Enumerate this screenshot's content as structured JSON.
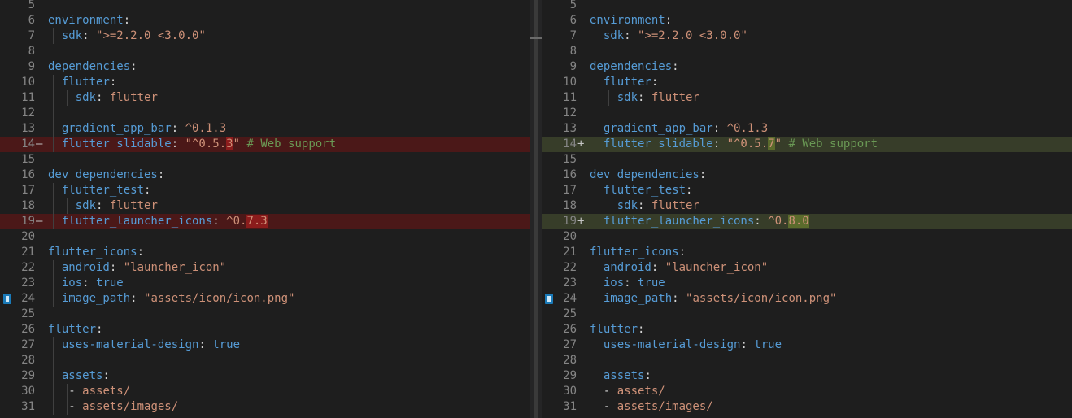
{
  "diff": {
    "left": [
      {
        "num": "5",
        "tokens": []
      },
      {
        "num": "6",
        "tokens": [
          {
            "t": "environment",
            "c": "k"
          },
          {
            "t": ":",
            "c": "p"
          }
        ]
      },
      {
        "num": "7",
        "guides": 1,
        "tokens": [
          {
            "t": "  "
          },
          {
            "t": "sdk",
            "c": "k"
          },
          {
            "t": ": ",
            "c": "p"
          },
          {
            "t": "\">=2.2.0 <3.0.0\"",
            "c": "s"
          }
        ]
      },
      {
        "num": "8",
        "tokens": []
      },
      {
        "num": "9",
        "tokens": [
          {
            "t": "dependencies",
            "c": "k"
          },
          {
            "t": ":",
            "c": "p"
          }
        ]
      },
      {
        "num": "10",
        "guides": 1,
        "tokens": [
          {
            "t": "  "
          },
          {
            "t": "flutter",
            "c": "k"
          },
          {
            "t": ":",
            "c": "p"
          }
        ]
      },
      {
        "num": "11",
        "guides": 2,
        "tokens": [
          {
            "t": "    "
          },
          {
            "t": "sdk",
            "c": "k"
          },
          {
            "t": ": ",
            "c": "p"
          },
          {
            "t": "flutter",
            "c": "s"
          }
        ]
      },
      {
        "num": "12",
        "guides": 1,
        "tokens": []
      },
      {
        "num": "13",
        "guides": 1,
        "tokens": [
          {
            "t": "  "
          },
          {
            "t": "gradient_app_bar",
            "c": "k"
          },
          {
            "t": ": ",
            "c": "p"
          },
          {
            "t": "^0.1.3",
            "c": "s"
          }
        ]
      },
      {
        "num": "14",
        "mark": "—",
        "type": "del",
        "guides": 1,
        "tokens": [
          {
            "t": "  "
          },
          {
            "t": "flutter_slidable",
            "c": "k"
          },
          {
            "t": ": ",
            "c": "p"
          },
          {
            "t": "\"^0.5.",
            "c": "s"
          },
          {
            "t": "3",
            "c": "s",
            "h": "hd"
          },
          {
            "t": "\"",
            "c": "s"
          },
          {
            "t": " # Web support",
            "c": "c"
          }
        ]
      },
      {
        "num": "15",
        "tokens": []
      },
      {
        "num": "16",
        "tokens": [
          {
            "t": "dev_dependencies",
            "c": "k"
          },
          {
            "t": ":",
            "c": "p"
          }
        ]
      },
      {
        "num": "17",
        "guides": 1,
        "tokens": [
          {
            "t": "  "
          },
          {
            "t": "flutter_test",
            "c": "k"
          },
          {
            "t": ":",
            "c": "p"
          }
        ]
      },
      {
        "num": "18",
        "guides": 2,
        "tokens": [
          {
            "t": "    "
          },
          {
            "t": "sdk",
            "c": "k"
          },
          {
            "t": ": ",
            "c": "p"
          },
          {
            "t": "flutter",
            "c": "s"
          }
        ]
      },
      {
        "num": "19",
        "mark": "—",
        "type": "del",
        "guides": 1,
        "tokens": [
          {
            "t": "  "
          },
          {
            "t": "flutter_launcher_icons",
            "c": "k"
          },
          {
            "t": ": ",
            "c": "p"
          },
          {
            "t": "^0.",
            "c": "s"
          },
          {
            "t": "7.3",
            "c": "s",
            "h": "hd"
          }
        ]
      },
      {
        "num": "20",
        "tokens": []
      },
      {
        "num": "21",
        "tokens": [
          {
            "t": "flutter_icons",
            "c": "k"
          },
          {
            "t": ":",
            "c": "p"
          }
        ]
      },
      {
        "num": "22",
        "guides": 1,
        "tokens": [
          {
            "t": "  "
          },
          {
            "t": "android",
            "c": "k"
          },
          {
            "t": ": ",
            "c": "p"
          },
          {
            "t": "\"launcher_icon\"",
            "c": "s"
          }
        ]
      },
      {
        "num": "23",
        "guides": 1,
        "tokens": [
          {
            "t": "  "
          },
          {
            "t": "ios",
            "c": "k"
          },
          {
            "t": ": ",
            "c": "p"
          },
          {
            "t": "true",
            "c": "k"
          }
        ]
      },
      {
        "num": "24",
        "bookmark": true,
        "guides": 1,
        "tokens": [
          {
            "t": "  "
          },
          {
            "t": "image_path",
            "c": "k"
          },
          {
            "t": ": ",
            "c": "p"
          },
          {
            "t": "\"assets/icon/icon.png\"",
            "c": "s"
          }
        ]
      },
      {
        "num": "25",
        "tokens": []
      },
      {
        "num": "26",
        "tokens": [
          {
            "t": "flutter",
            "c": "k"
          },
          {
            "t": ":",
            "c": "p"
          }
        ]
      },
      {
        "num": "27",
        "guides": 1,
        "tokens": [
          {
            "t": "  "
          },
          {
            "t": "uses-material-design",
            "c": "k"
          },
          {
            "t": ": ",
            "c": "p"
          },
          {
            "t": "true",
            "c": "k"
          }
        ]
      },
      {
        "num": "28",
        "guides": 1,
        "tokens": []
      },
      {
        "num": "29",
        "guides": 1,
        "tokens": [
          {
            "t": "  "
          },
          {
            "t": "assets",
            "c": "k"
          },
          {
            "t": ":",
            "c": "p"
          }
        ]
      },
      {
        "num": "30",
        "guides": 2,
        "tokens": [
          {
            "t": "  "
          },
          {
            "t": " - ",
            "c": "p"
          },
          {
            "t": "assets/",
            "c": "s"
          }
        ]
      },
      {
        "num": "31",
        "guides": 2,
        "tokens": [
          {
            "t": "  "
          },
          {
            "t": " - ",
            "c": "p"
          },
          {
            "t": "assets/images/",
            "c": "s"
          }
        ]
      }
    ],
    "right": [
      {
        "num": "5",
        "tokens": []
      },
      {
        "num": "6",
        "tokens": [
          {
            "t": "environment",
            "c": "k"
          },
          {
            "t": ":",
            "c": "p"
          }
        ]
      },
      {
        "num": "7",
        "guides": 1,
        "tokens": [
          {
            "t": "  "
          },
          {
            "t": "sdk",
            "c": "k"
          },
          {
            "t": ": ",
            "c": "p"
          },
          {
            "t": "\">=2.2.0 <3.0.0\"",
            "c": "s"
          }
        ]
      },
      {
        "num": "8",
        "tokens": []
      },
      {
        "num": "9",
        "tokens": [
          {
            "t": "dependencies",
            "c": "k"
          },
          {
            "t": ":",
            "c": "p"
          }
        ]
      },
      {
        "num": "10",
        "guides": 1,
        "tokens": [
          {
            "t": "  "
          },
          {
            "t": "flutter",
            "c": "k"
          },
          {
            "t": ":",
            "c": "p"
          }
        ]
      },
      {
        "num": "11",
        "guides": 2,
        "tokens": [
          {
            "t": "    "
          },
          {
            "t": "sdk",
            "c": "k"
          },
          {
            "t": ": ",
            "c": "p"
          },
          {
            "t": "flutter",
            "c": "s"
          }
        ]
      },
      {
        "num": "12",
        "tokens": []
      },
      {
        "num": "13",
        "tokens": [
          {
            "t": "  "
          },
          {
            "t": "gradient_app_bar",
            "c": "k"
          },
          {
            "t": ": ",
            "c": "p"
          },
          {
            "t": "^0.1.3",
            "c": "s"
          }
        ]
      },
      {
        "num": "14",
        "mark": "+",
        "type": "ins",
        "tokens": [
          {
            "t": "  "
          },
          {
            "t": "flutter_slidable",
            "c": "k"
          },
          {
            "t": ": ",
            "c": "p"
          },
          {
            "t": "\"^0.5.",
            "c": "s"
          },
          {
            "t": "7",
            "c": "s",
            "h": "hi"
          },
          {
            "t": "\"",
            "c": "s"
          },
          {
            "t": " # Web support",
            "c": "c"
          }
        ]
      },
      {
        "num": "15",
        "tokens": []
      },
      {
        "num": "16",
        "tokens": [
          {
            "t": "dev_dependencies",
            "c": "k"
          },
          {
            "t": ":",
            "c": "p"
          }
        ]
      },
      {
        "num": "17",
        "tokens": [
          {
            "t": "  "
          },
          {
            "t": "flutter_test",
            "c": "k"
          },
          {
            "t": ":",
            "c": "p"
          }
        ]
      },
      {
        "num": "18",
        "tokens": [
          {
            "t": "    "
          },
          {
            "t": "sdk",
            "c": "k"
          },
          {
            "t": ": ",
            "c": "p"
          },
          {
            "t": "flutter",
            "c": "s"
          }
        ]
      },
      {
        "num": "19",
        "mark": "+",
        "type": "ins",
        "tokens": [
          {
            "t": "  "
          },
          {
            "t": "flutter_launcher_icons",
            "c": "k"
          },
          {
            "t": ": ",
            "c": "p"
          },
          {
            "t": "^0.",
            "c": "s"
          },
          {
            "t": "8.0",
            "c": "s",
            "h": "hi"
          }
        ]
      },
      {
        "num": "20",
        "tokens": []
      },
      {
        "num": "21",
        "tokens": [
          {
            "t": "flutter_icons",
            "c": "k"
          },
          {
            "t": ":",
            "c": "p"
          }
        ]
      },
      {
        "num": "22",
        "tokens": [
          {
            "t": "  "
          },
          {
            "t": "android",
            "c": "k"
          },
          {
            "t": ": ",
            "c": "p"
          },
          {
            "t": "\"launcher_icon\"",
            "c": "s"
          }
        ]
      },
      {
        "num": "23",
        "tokens": [
          {
            "t": "  "
          },
          {
            "t": "ios",
            "c": "k"
          },
          {
            "t": ": ",
            "c": "p"
          },
          {
            "t": "true",
            "c": "k"
          }
        ]
      },
      {
        "num": "24",
        "bookmark": true,
        "tokens": [
          {
            "t": "  "
          },
          {
            "t": "image_path",
            "c": "k"
          },
          {
            "t": ": ",
            "c": "p"
          },
          {
            "t": "\"assets/icon/icon.png\"",
            "c": "s"
          }
        ]
      },
      {
        "num": "25",
        "tokens": []
      },
      {
        "num": "26",
        "tokens": [
          {
            "t": "flutter",
            "c": "k"
          },
          {
            "t": ":",
            "c": "p"
          }
        ]
      },
      {
        "num": "27",
        "tokens": [
          {
            "t": "  "
          },
          {
            "t": "uses-material-design",
            "c": "k"
          },
          {
            "t": ": ",
            "c": "p"
          },
          {
            "t": "true",
            "c": "k"
          }
        ]
      },
      {
        "num": "28",
        "tokens": []
      },
      {
        "num": "29",
        "tokens": [
          {
            "t": "  "
          },
          {
            "t": "assets",
            "c": "k"
          },
          {
            "t": ":",
            "c": "p"
          }
        ]
      },
      {
        "num": "30",
        "tokens": [
          {
            "t": "  "
          },
          {
            "t": "- ",
            "c": "p"
          },
          {
            "t": "assets/",
            "c": "s"
          }
        ]
      },
      {
        "num": "31",
        "tokens": [
          {
            "t": "  "
          },
          {
            "t": "- ",
            "c": "p"
          },
          {
            "t": "assets/images/",
            "c": "s"
          }
        ]
      }
    ]
  }
}
